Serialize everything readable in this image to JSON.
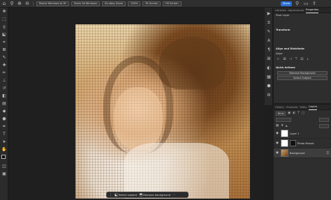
{
  "options_bar": {
    "buttons": [
      "Resize Windows to Fit",
      "Zoom All Windows",
      "Scrubby Zoom",
      "100%",
      "Fit Screen",
      "Fill Screen"
    ],
    "share_label": "Share"
  },
  "properties_panel": {
    "tabs": [
      "Libraries",
      "Adjustments",
      "Properties"
    ],
    "pixel_layer_label": "Pixel Layer",
    "transform_heading": "Transform",
    "align_heading": "Align and Distribute",
    "align_sub": "Align:",
    "quick_actions_heading": "Quick Actions",
    "remove_background_label": "Remove Background",
    "select_subject_label": "Select Subject"
  },
  "layers_panel": {
    "tabs": [
      "History",
      "Channels",
      "Paths",
      "Layers"
    ],
    "kind_label": "Kind",
    "layers": [
      {
        "name": "Layer 1",
        "thumb": "white"
      },
      {
        "name": "Photo Mosaic",
        "thumb": "white"
      },
      {
        "name": "Background",
        "thumb": "photo"
      }
    ]
  },
  "taskbar": {
    "select_subject": "Select subject",
    "remove_background": "Remove background"
  },
  "colors": {
    "accent": "#2a6fd6",
    "panel_bg": "#2e2e2e",
    "workspace_bg": "#1f1f1f"
  }
}
